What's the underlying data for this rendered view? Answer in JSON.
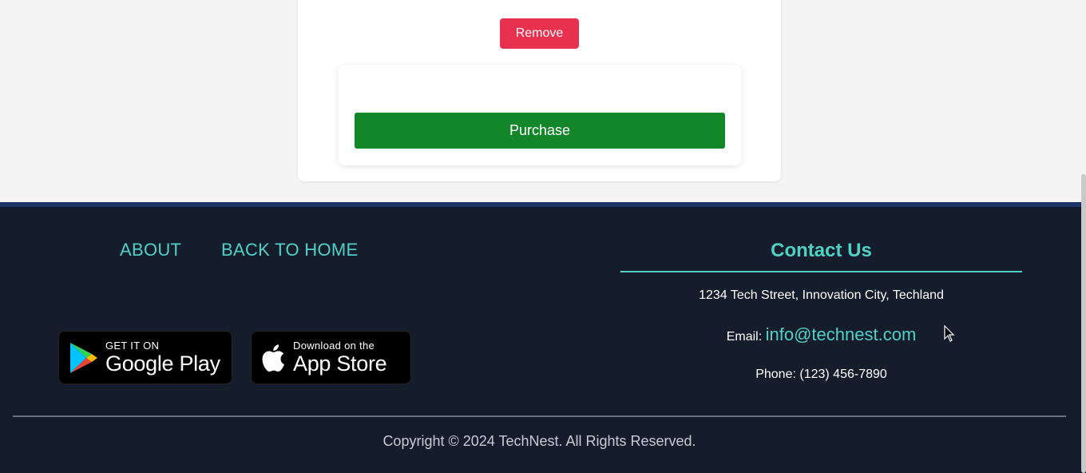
{
  "cart": {
    "remove_label": "Remove",
    "purchase_label": "Purchase"
  },
  "footer": {
    "nav": {
      "about_label": "ABOUT",
      "home_label": "BACK TO HOME"
    },
    "badges": {
      "google_small": "GET IT ON",
      "google_big": "Google Play",
      "apple_small": "Download on the",
      "apple_big": "App Store"
    },
    "contact": {
      "title": "Contact Us",
      "address": "1234 Tech Street, Innovation City, Techland",
      "email_label": "Email:",
      "email_value": "info@technest.com",
      "phone_label": "Phone:",
      "phone_value": "(123) 456-7890"
    },
    "copyright": "Copyright © 2024 TechNest. All Rights Reserved."
  },
  "colors": {
    "accent": "#4fd1c5",
    "footer_bg": "#151d2c",
    "remove_button": "#e8314f",
    "purchase_button": "#13862a"
  },
  "icons": [
    "google-play-icon",
    "apple-icon",
    "mouse-cursor-icon"
  ]
}
